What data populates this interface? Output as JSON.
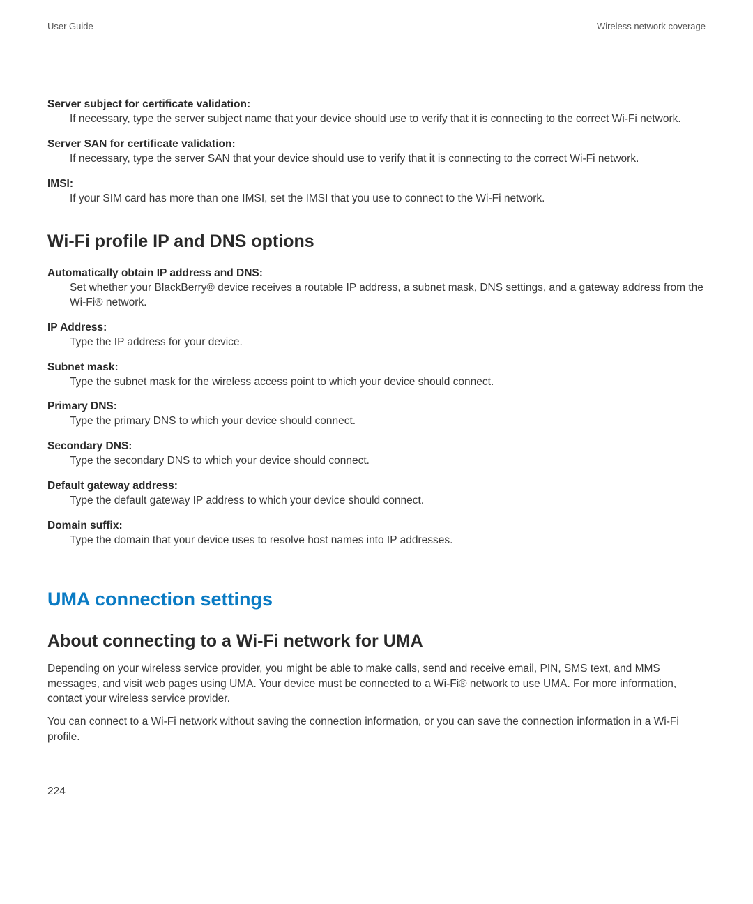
{
  "header": {
    "left": "User Guide",
    "right": "Wireless network coverage"
  },
  "defs_top": [
    {
      "term": "Server subject for certificate validation:",
      "desc": "If necessary, type the server subject name that your device should use to verify that it is connecting to the correct Wi-Fi network."
    },
    {
      "term": "Server SAN for certificate validation:",
      "desc": "If necessary, type the server SAN that your device should use to verify that it is connecting to the correct Wi-Fi network."
    },
    {
      "term": "IMSI:",
      "desc": "If your SIM card has more than one IMSI, set the IMSI that you use to connect to the Wi-Fi network."
    }
  ],
  "section_ipdns": {
    "heading": "Wi-Fi profile IP and DNS options",
    "items": [
      {
        "term": "Automatically obtain IP address and DNS:",
        "desc": "Set whether your BlackBerry® device receives a routable IP address, a subnet mask, DNS settings, and a gateway address from the Wi-Fi® network."
      },
      {
        "term": "IP Address:",
        "desc": "Type the IP address for your device."
      },
      {
        "term": "Subnet mask:",
        "desc": "Type the subnet mask for the wireless access point to which your device should connect."
      },
      {
        "term": "Primary DNS:",
        "desc": "Type the primary DNS to which your device should connect."
      },
      {
        "term": "Secondary DNS:",
        "desc": "Type the secondary DNS to which your device should connect."
      },
      {
        "term": "Default gateway address:",
        "desc": "Type the default gateway IP address to which your device should connect."
      },
      {
        "term": "Domain suffix:",
        "desc": "Type the domain that your device uses to resolve host names into IP addresses."
      }
    ]
  },
  "section_uma": {
    "heading": "UMA connection settings",
    "sub": {
      "heading": "About connecting to a Wi-Fi network for UMA",
      "paras": [
        "Depending on your wireless service provider, you might be able to make calls, send and receive email, PIN, SMS text, and MMS messages, and visit web pages using UMA. Your device must be connected to a Wi-Fi® network to use UMA. For more information, contact your wireless service provider.",
        "You can connect to a Wi-Fi network without saving the connection information, or you can save the connection information in a Wi-Fi profile."
      ]
    }
  },
  "page_number": "224"
}
